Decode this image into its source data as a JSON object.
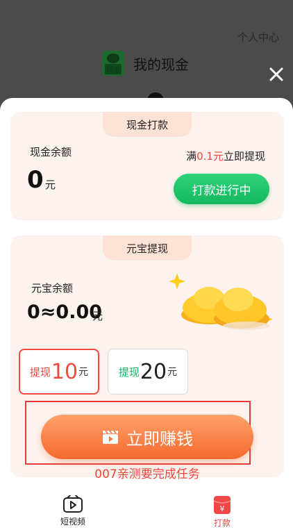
{
  "header": {
    "personal_center": "个人中心",
    "title": "我的现金",
    "logo_text": "现金"
  },
  "cash_card": {
    "tab": "现金打款",
    "balance_label": "现金余额",
    "balance_value": "0",
    "balance_unit": "元",
    "threshold_prefix": "满",
    "threshold_amount": "0.1元",
    "threshold_suffix": "立即提现",
    "button": "打款进行中"
  },
  "ingot_card": {
    "tab": "元宝提现",
    "balance_label": "元宝余额",
    "balance_value": "0≈0.00",
    "balance_unit": "元",
    "options": [
      {
        "label": "提现",
        "amount": "10",
        "unit": "元",
        "selected": true
      },
      {
        "label": "提现",
        "amount": "20",
        "unit": "元",
        "selected": false
      }
    ],
    "earn_button": "立即赚钱",
    "task_note": "007亲测要完成任务"
  },
  "bottom_nav": [
    {
      "label": "短视频",
      "icon": "video-icon",
      "active": false
    },
    {
      "label": "打款",
      "icon": "red-envelope-icon",
      "active": true
    }
  ],
  "colors": {
    "accent_red": "#f0453a",
    "green": "#16b766",
    "orange": "#f56a2e",
    "card_bg": "#fdf3ee"
  }
}
